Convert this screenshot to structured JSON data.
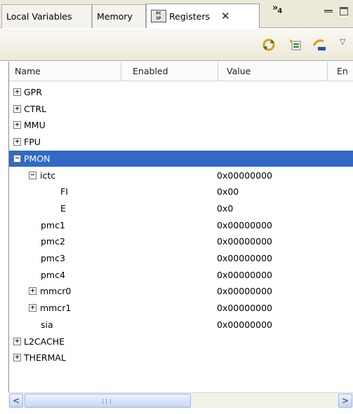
{
  "tabs": [
    {
      "label": "Local Variables"
    },
    {
      "label": "Memory"
    },
    {
      "label": "Registers",
      "icon": "registers-icon",
      "icon_text_top": "PC",
      "icon_text_bottom": "SP"
    }
  ],
  "overflow": {
    "glyph": "»",
    "count": "4"
  },
  "columns": {
    "name": "Name",
    "enabled": "Enabled",
    "value": "Value",
    "more": "En"
  },
  "tree": [
    {
      "label": "GPR",
      "level": 0,
      "expander": "+",
      "value": ""
    },
    {
      "label": "CTRL",
      "level": 0,
      "expander": "+",
      "value": ""
    },
    {
      "label": "MMU",
      "level": 0,
      "expander": "+",
      "value": ""
    },
    {
      "label": "FPU",
      "level": 0,
      "expander": "+",
      "value": ""
    },
    {
      "label": "PMON",
      "level": 0,
      "expander": "−",
      "value": "",
      "selected": true
    },
    {
      "label": "ictc",
      "level": 1,
      "expander": "−",
      "value": "0x00000000"
    },
    {
      "label": "FI",
      "level": 2,
      "expander": "",
      "value": "0x00"
    },
    {
      "label": "E",
      "level": 2,
      "expander": "",
      "value": "0x0"
    },
    {
      "label": "pmc1",
      "level": 1,
      "expander": "",
      "value": "0x00000000"
    },
    {
      "label": "pmc2",
      "level": 1,
      "expander": "",
      "value": "0x00000000"
    },
    {
      "label": "pmc3",
      "level": 1,
      "expander": "",
      "value": "0x00000000"
    },
    {
      "label": "pmc4",
      "level": 1,
      "expander": "",
      "value": "0x00000000"
    },
    {
      "label": "mmcr0",
      "level": 1,
      "expander": "+",
      "value": "0x00000000"
    },
    {
      "label": "mmcr1",
      "level": 1,
      "expander": "+",
      "value": "0x00000000"
    },
    {
      "label": "sia",
      "level": 1,
      "expander": "",
      "value": "0x00000000"
    },
    {
      "label": "L2CACHE",
      "level": 0,
      "expander": "+",
      "value": ""
    },
    {
      "label": "THERMAL",
      "level": 0,
      "expander": "+",
      "value": ""
    }
  ],
  "colors": {
    "selection": "#316ac5",
    "tabbar": "#ece9d8",
    "scrollbar": "#c6d6f5"
  }
}
